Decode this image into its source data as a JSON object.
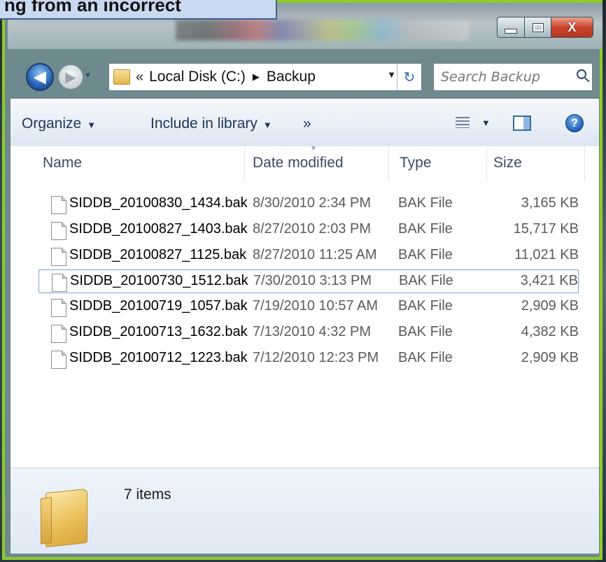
{
  "banner": {
    "text": "ng from an incorrect"
  },
  "window": {
    "caption": {
      "minimize": "_",
      "maximize": "□",
      "close": "X"
    },
    "nav": {
      "back": "◀",
      "forward": "▶",
      "recent": "▼"
    },
    "address": {
      "chevron": "«",
      "parts": [
        "Local Disk (C:)",
        "Backup"
      ],
      "separator": "▶",
      "dropdown": "▼",
      "refresh": "↻"
    },
    "search": {
      "placeholder": "Search Backup"
    }
  },
  "toolbar": {
    "organize": "Organize",
    "include_in_library": "Include in library",
    "more": "»",
    "views_dropdown": "▼",
    "help": "?"
  },
  "columns": {
    "name": "Name",
    "date": "Date modified",
    "type": "Type",
    "size": "Size"
  },
  "files": [
    {
      "name": "SIDDB_20100830_1434.bak",
      "date": "8/30/2010 2:34 PM",
      "type": "BAK File",
      "size": "3,165 KB"
    },
    {
      "name": "SIDDB_20100827_1403.bak",
      "date": "8/27/2010 2:03 PM",
      "type": "BAK File",
      "size": "15,717 KB"
    },
    {
      "name": "SIDDB_20100827_1125.bak",
      "date": "8/27/2010 11:25 AM",
      "type": "BAK File",
      "size": "11,021 KB"
    },
    {
      "name": "SIDDB_20100730_1512.bak",
      "date": "7/30/2010 3:13 PM",
      "type": "BAK File",
      "size": "3,421 KB"
    },
    {
      "name": "SIDDB_20100719_1057.bak",
      "date": "7/19/2010 10:57 AM",
      "type": "BAK File",
      "size": "2,909 KB"
    },
    {
      "name": "SIDDB_20100713_1632.bak",
      "date": "7/13/2010 4:32 PM",
      "type": "BAK File",
      "size": "4,382 KB"
    },
    {
      "name": "SIDDB_20100712_1223.bak",
      "date": "7/12/2010 12:23 PM",
      "type": "BAK File",
      "size": "2,909 KB"
    }
  ],
  "details": {
    "items_count": "7 items"
  },
  "colors": {
    "frame_border": "#8ecc2a",
    "focus_border": "#7da2ce",
    "close_button": "#c8432a"
  }
}
